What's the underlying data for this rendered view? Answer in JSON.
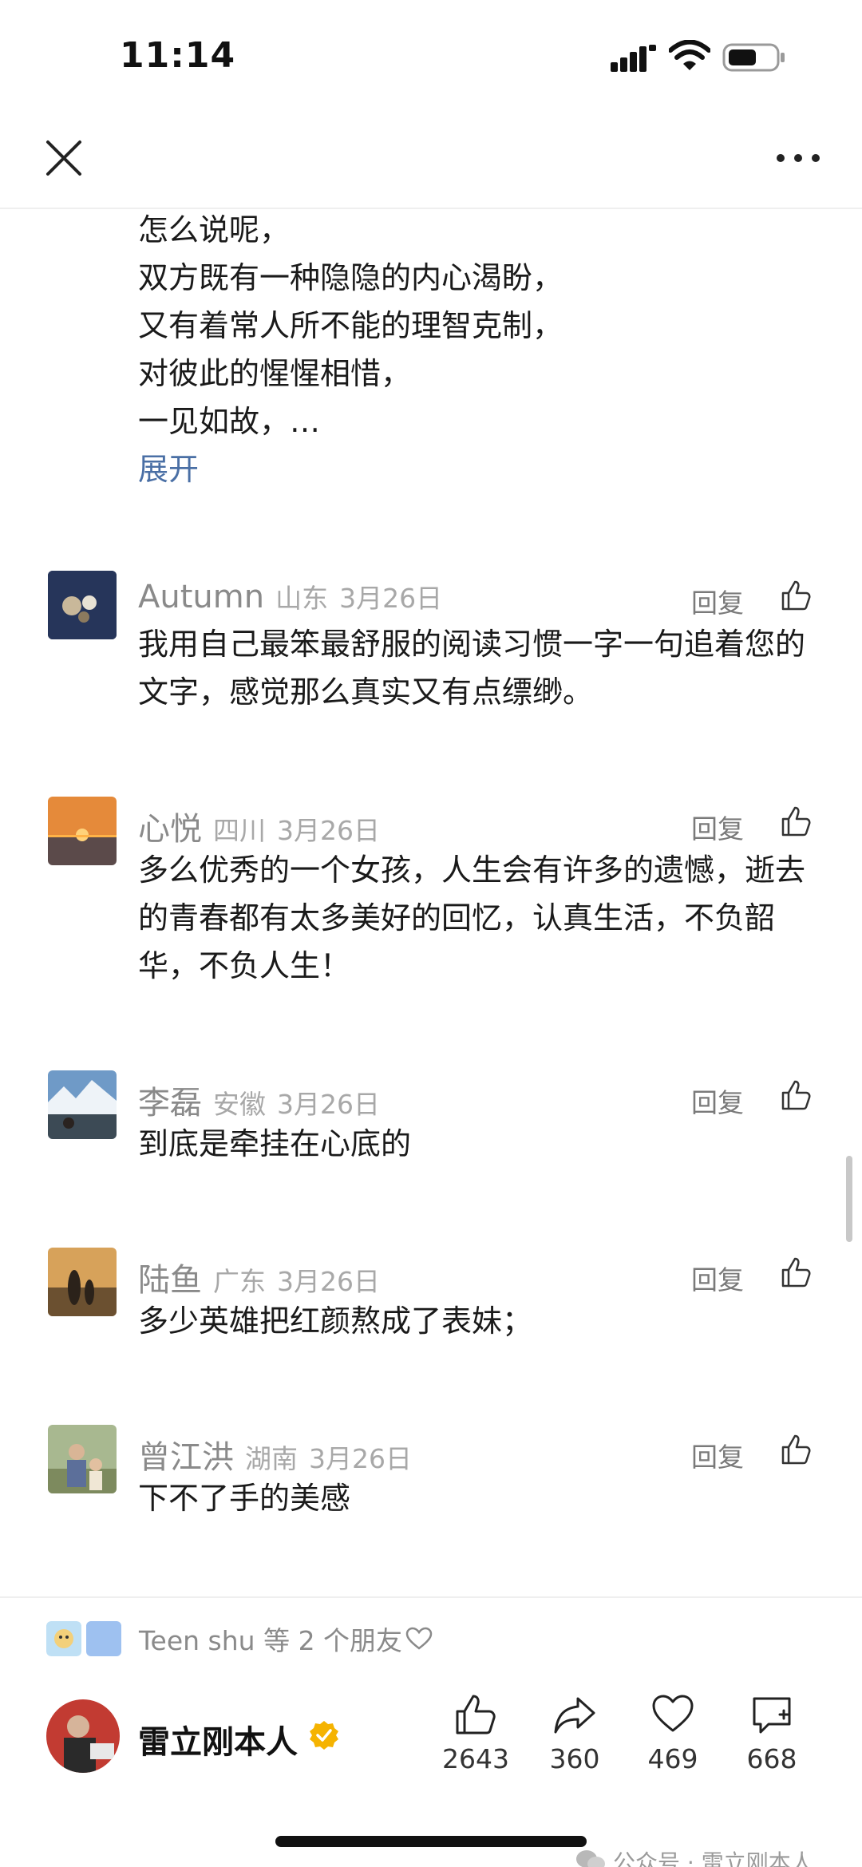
{
  "status_bar": {
    "time": "11:14"
  },
  "nav": {
    "close_icon": "close-icon",
    "more_icon": "more-icon"
  },
  "article": {
    "lines": [
      "怎么说呢，",
      "双方既有一种隐隐的内心渴盼，",
      "又有着常人所不能的理智克制，",
      "对彼此的惺惺相惜，",
      "一见如故，…"
    ],
    "expand_label": "展开"
  },
  "comments": [
    {
      "name": "Autumn",
      "region": "山东",
      "date": "3月26日",
      "reply_label": "回复",
      "text": "我用自己最笨最舒服的阅读习惯一字一句追着您的文字，感觉那么真实又有点缥缈。"
    },
    {
      "name": "心悦",
      "region": "四川",
      "date": "3月26日",
      "reply_label": "回复",
      "text": "多么优秀的一个女孩，人生会有许多的遗憾，逝去的青春都有太多美好的回忆，认真生活，不负韶华，不负人生！"
    },
    {
      "name": "李磊",
      "region": "安徽",
      "date": "3月26日",
      "reply_label": "回复",
      "text": "到底是牵挂在心底的"
    },
    {
      "name": "陆鱼",
      "region": "广东",
      "date": "3月26日",
      "reply_label": "回复",
      "text": "多少英雄把红颜熬成了表妹；"
    },
    {
      "name": "曾江洪",
      "region": "湖南",
      "date": "3月26日",
      "reply_label": "回复",
      "text": "下不了手的美感"
    }
  ],
  "bottom": {
    "friends_text": "Teen shu 等 2 个朋友",
    "author_name": "雷立刚本人",
    "actions": [
      {
        "icon": "thumb-up-icon",
        "count": "2643"
      },
      {
        "icon": "share-icon",
        "count": "360"
      },
      {
        "icon": "heart-icon",
        "count": "469"
      },
      {
        "icon": "comment-icon",
        "count": "668"
      }
    ],
    "watermark": "公众号 · 雷立刚本人"
  },
  "colors": {
    "link": "#4a6fa5",
    "meta": "#a8a8a8",
    "verified": "#f5b301"
  }
}
